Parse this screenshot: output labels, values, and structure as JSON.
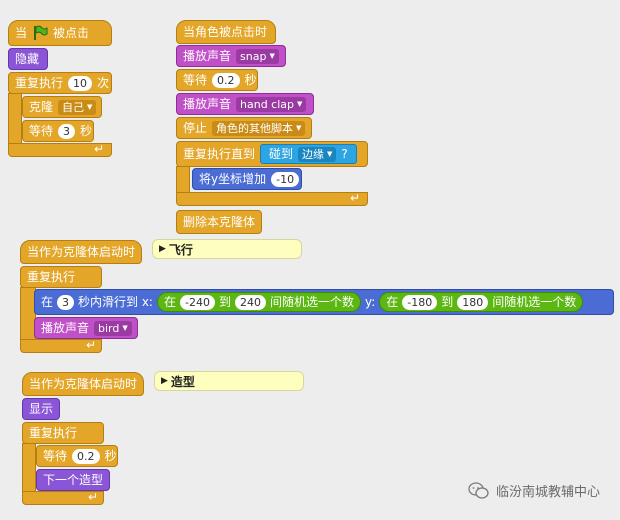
{
  "script1": {
    "hat_prefix": "当",
    "hat_suffix": "被点击",
    "hide": "隐藏",
    "repeat_prefix": "重复执行",
    "repeat_count": "10",
    "repeat_suffix": "次",
    "clone": "克隆",
    "clone_target": "自己",
    "wait": "等待",
    "wait_value": "3",
    "wait_unit": "秒"
  },
  "script2": {
    "hat": "当角色被点击时",
    "play1": "播放声音",
    "sound1": "snap",
    "wait": "等待",
    "wait_value": "0.2",
    "wait_unit": "秒",
    "play2": "播放声音",
    "sound2": "hand clap",
    "stop": "停止",
    "stop_option": "角色的其他脚本",
    "repeat_until": "重复执行直到",
    "touching": "碰到",
    "touching_target": "边缘",
    "touching_q": "?",
    "change_y": "将y坐标增加",
    "change_y_value": "-10",
    "delete_clone": "删除本克隆体"
  },
  "script3": {
    "hat": "当作为克隆体启动时",
    "comment": "飞行",
    "forever": "重复执行",
    "glide_in": "在",
    "glide_secs": "3",
    "glide_mid": "秒内滑行到 x:",
    "pick1_in": "在",
    "pick1_from": "-240",
    "pick1_to_word": "到",
    "pick1_to": "240",
    "pick1_suffix": "间随机选一个数",
    "y_label": "y:",
    "pick2_in": "在",
    "pick2_from": "-180",
    "pick2_to_word": "到",
    "pick2_to": "180",
    "pick2_suffix": "间随机选一个数",
    "play": "播放声音",
    "sound": "bird"
  },
  "script4": {
    "hat": "当作为克隆体启动时",
    "comment": "造型",
    "show": "显示",
    "forever": "重复执行",
    "wait": "等待",
    "wait_value": "0.2",
    "wait_unit": "秒",
    "next_costume": "下一个造型"
  },
  "watermark": "临汾南城教辅中心",
  "colors": {
    "control": "#e3a629",
    "looks": "#8a55d6",
    "sound": "#c050c7",
    "motion": "#4a6cd4",
    "operators": "#5cb712",
    "sensing": "#2ca5e2",
    "comment": "#fefebe"
  }
}
